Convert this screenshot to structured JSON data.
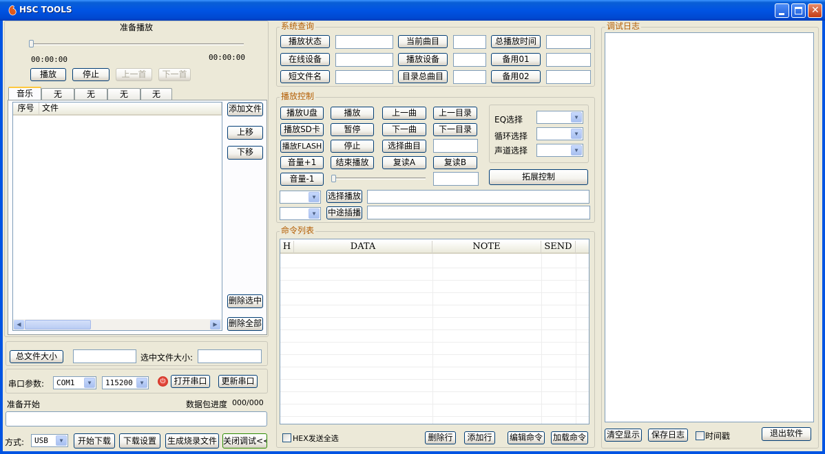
{
  "app": {
    "title": "HSC TOOLS"
  },
  "player": {
    "status": "准备播放",
    "time_current": "00:00:00",
    "time_total": "00:00:00",
    "progress": 0,
    "buttons": {
      "play": "播放",
      "stop": "停止",
      "prev": "上一首",
      "next": "下一首"
    }
  },
  "tabs": [
    "音乐",
    "无",
    "无",
    "无",
    "无"
  ],
  "file_list": {
    "columns": [
      "序号",
      "文件"
    ],
    "add_file": "添加文件",
    "move_up": "上移",
    "move_down": "下移",
    "delete_selected": "删除选中",
    "delete_all": "删除全部"
  },
  "size": {
    "total_button": "总文件大小",
    "total_value": "",
    "selected_label": "选中文件大小:",
    "selected_value": ""
  },
  "serial": {
    "label": "串口参数:",
    "port": "COM1",
    "baud": "115200",
    "open": "打开串口",
    "refresh": "更新串口"
  },
  "download": {
    "status": "准备开始",
    "packet_label": "数据包进度",
    "packet_value": "000/000",
    "mode_label": "方式:",
    "mode": "USB",
    "start": "开始下载",
    "settings": "下载设置",
    "generate": "生成烧录文件",
    "close_debug": "关闭调试<<"
  },
  "system_query": {
    "title": "系统查询",
    "rows": [
      [
        "播放状态",
        "当前曲目",
        "总播放时间"
      ],
      [
        "在线设备",
        "播放设备",
        "备用01"
      ],
      [
        "短文件名",
        "目录总曲目",
        "备用02"
      ]
    ]
  },
  "play_control": {
    "title": "播放控制",
    "grid": [
      [
        "播放U盘",
        "播放",
        "上一曲",
        "上一目录"
      ],
      [
        "播放SD卡",
        "暂停",
        "下一曲",
        "下一目录"
      ],
      [
        "播放FLASH",
        "停止",
        "选择曲目"
      ],
      [
        "音量+1",
        "结束播放",
        "复读A",
        "复读B"
      ],
      [
        "音量-1"
      ]
    ],
    "eq_label": "EQ选择",
    "loop_label": "循环选择",
    "channel_label": "声道选择",
    "extended": "拓展控制",
    "select_play": "选择播放",
    "insert_play": "中途插播",
    "volume": 0
  },
  "commands": {
    "title": "命令列表",
    "columns": [
      "H",
      "DATA",
      "NOTE",
      "SEND"
    ],
    "hex_all": "HEX发送全选",
    "delete_row": "删除行",
    "add_row": "添加行",
    "edit_cmd": "编辑命令",
    "load_cmd": "加载命令"
  },
  "debug_log": {
    "title": "调试日志",
    "clear": "清空显示",
    "save": "保存日志",
    "timestamp": "时间戳",
    "exit": "退出软件"
  }
}
